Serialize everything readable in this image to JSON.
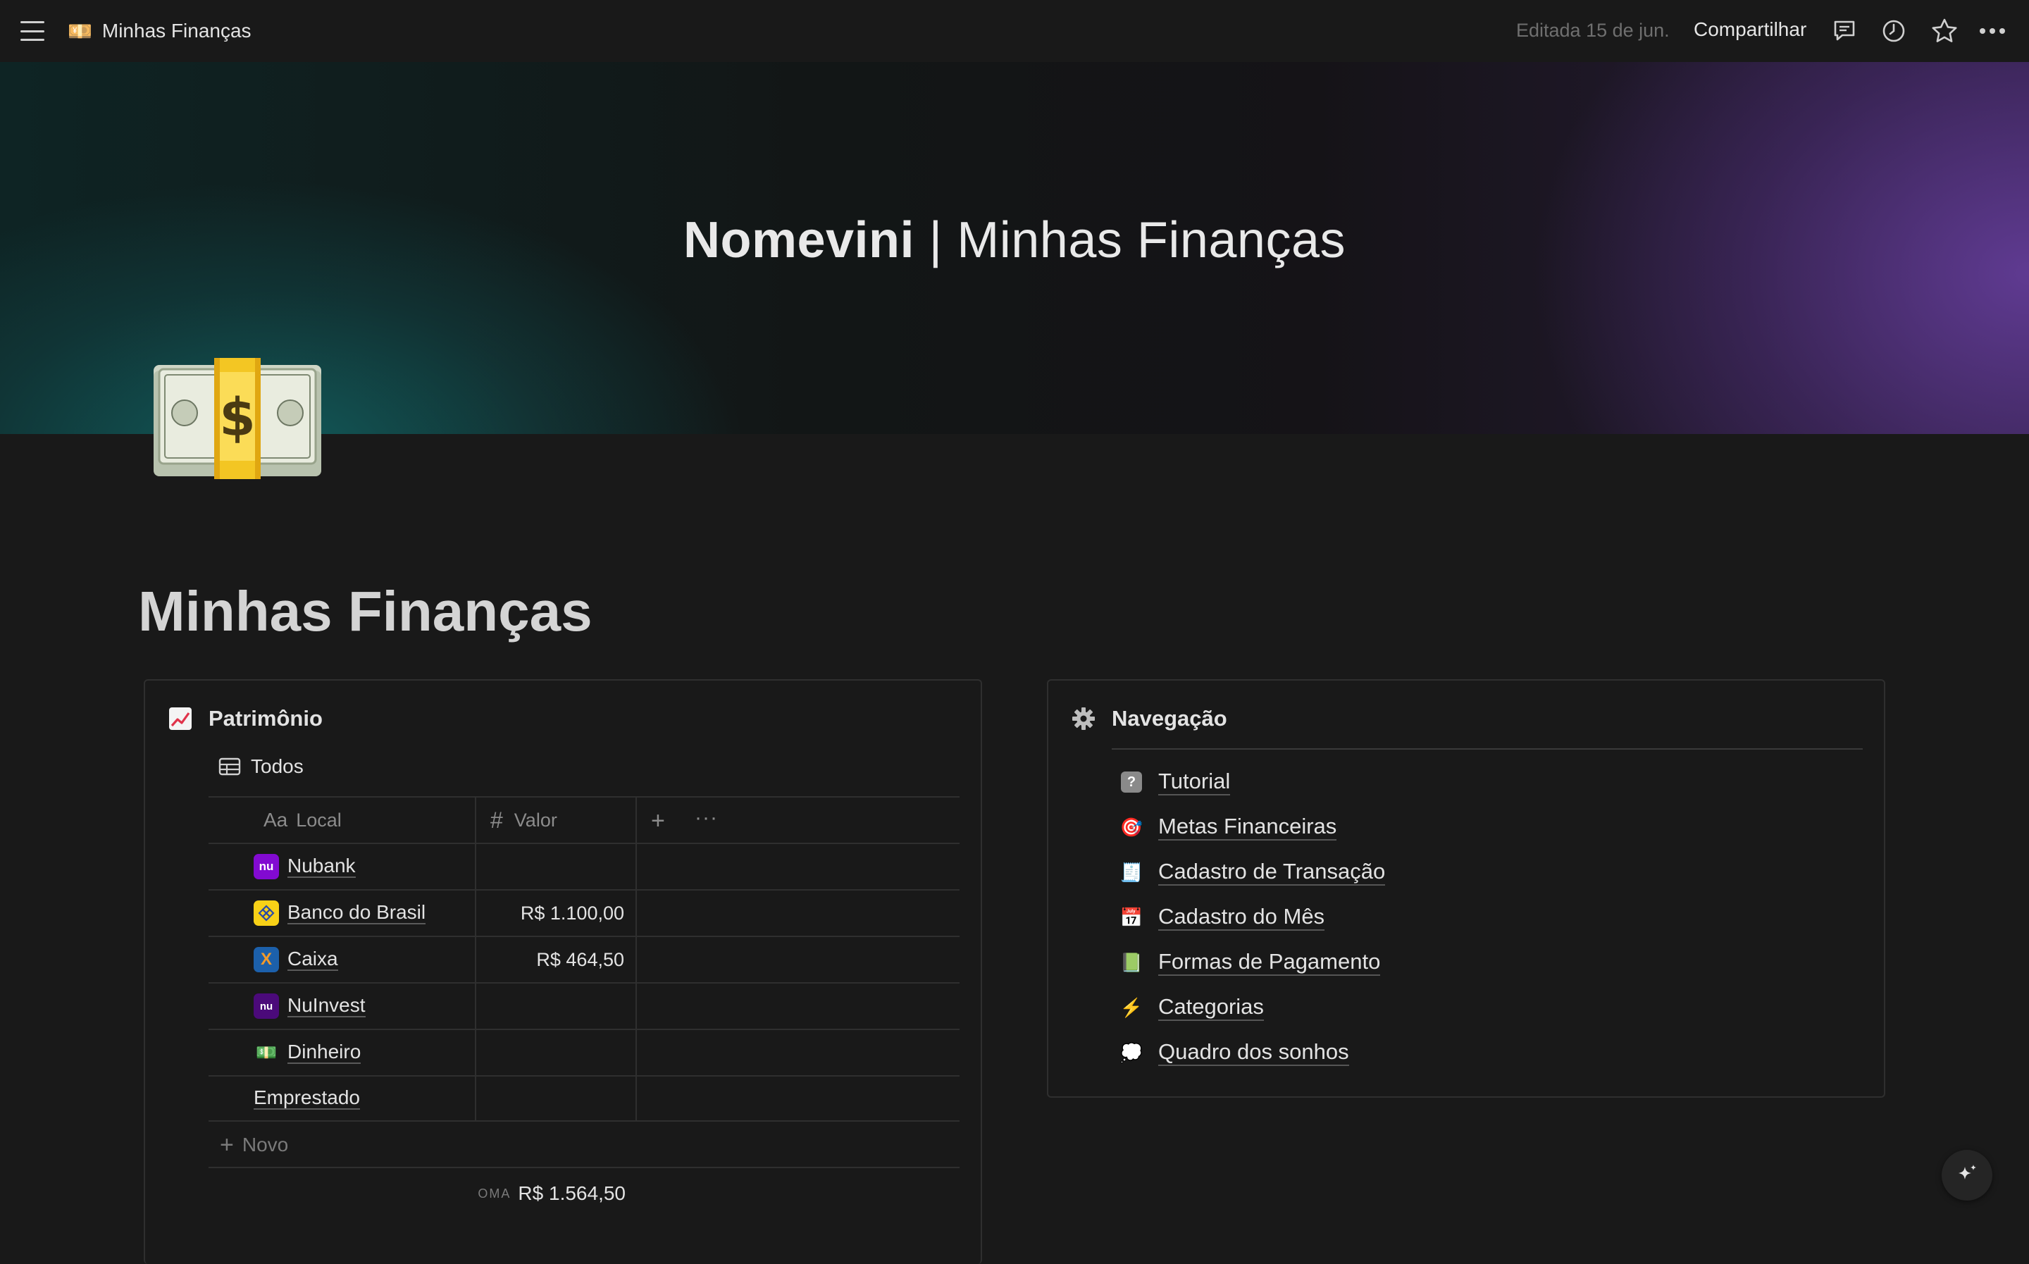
{
  "topbar": {
    "page_emoji": "💴",
    "page_title": "Minhas Finanças",
    "edited": "Editada 15 de jun.",
    "share": "Compartilhar",
    "icons": [
      "menu-icon",
      "comment-icon",
      "clock-icon",
      "star-icon",
      "more-icon"
    ]
  },
  "cover": {
    "title_bold": "Nomevini",
    "title_sep": " | ",
    "title_rest": "Minhas Finanças",
    "colors": {
      "teal": "#125f5f",
      "purple": "#623c96"
    }
  },
  "page": {
    "icon": "money-bag-icon",
    "title": "Minhas Finanças"
  },
  "patrimonio": {
    "title": "Patrimônio",
    "view": "Todos",
    "columns": {
      "local_prefix": "Aa",
      "local": "Local",
      "valor_prefix": "#",
      "valor": "Valor"
    },
    "rows": [
      {
        "name": "Nubank",
        "value": "",
        "logo": "nubank",
        "logo_text": "nu",
        "color": "#820ad1"
      },
      {
        "name": "Banco do Brasil",
        "value": "R$ 1.100,00",
        "logo": "bb",
        "logo_text": "",
        "color": "#f8d117"
      },
      {
        "name": "Caixa",
        "value": "R$ 464,50",
        "logo": "caixa",
        "logo_text": "X",
        "color": "#1c60ab"
      },
      {
        "name": "NuInvest",
        "value": "",
        "logo": "nuinvest",
        "logo_text": "nu",
        "color": "#4b0a7a"
      },
      {
        "name": "Dinheiro",
        "value": "",
        "logo": "cash",
        "logo_text": "💵",
        "color": ""
      },
      {
        "name": "Emprestado",
        "value": "",
        "logo": "",
        "logo_text": "",
        "color": ""
      }
    ],
    "new_label": "Novo",
    "sum_label": "OMA",
    "sum_value": "R$ 1.564,50"
  },
  "navegacao": {
    "title": "Navegação",
    "items": [
      {
        "label": "Tutorial",
        "icon": "question-icon",
        "glyph": "?"
      },
      {
        "label": "Metas Financeiras",
        "icon": "target-icon",
        "glyph": "🎯"
      },
      {
        "label": "Cadastro de Transação",
        "icon": "receipt-icon",
        "glyph": "🧾"
      },
      {
        "label": "Cadastro do Mês",
        "icon": "calendar-icon",
        "glyph": "📅"
      },
      {
        "label": "Formas de Pagamento",
        "icon": "green-book-icon",
        "glyph": "📗"
      },
      {
        "label": "Categorias",
        "icon": "lightning-icon",
        "glyph": "⚡"
      },
      {
        "label": "Quadro dos sonhos",
        "icon": "thought-bubble-icon",
        "glyph": "💭"
      }
    ]
  }
}
